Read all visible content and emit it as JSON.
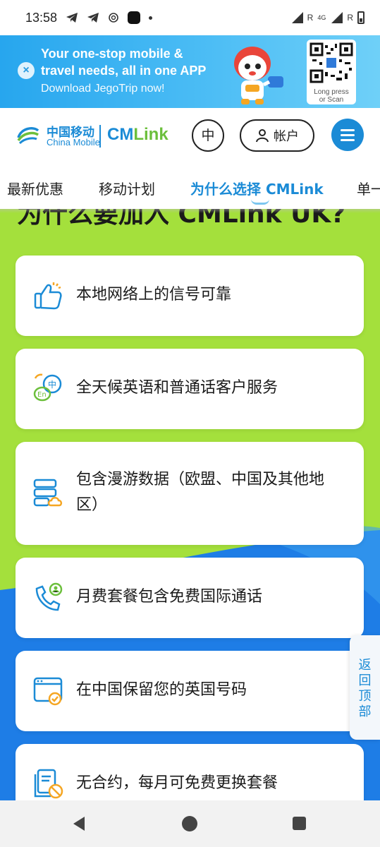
{
  "status_bar": {
    "time": "13:58",
    "icons": [
      "telegram-icon",
      "telegram-icon",
      "openai-icon",
      "app-icon",
      "dot-icon"
    ],
    "right_indicators": [
      "R",
      "4G",
      "R"
    ]
  },
  "banner": {
    "line1": "Your one-stop mobile &",
    "line2": "travel needs, all in one APP",
    "line3": "Download JegoTrip now!",
    "qr_label1": "Long press",
    "qr_label2": "or Scan"
  },
  "header": {
    "brand_cn": "中国移动",
    "brand_en": "China Mobile",
    "brand_cm": "CM",
    "brand_link": "Link",
    "lang_label": "中",
    "account_label": "帐户"
  },
  "tabs": [
    {
      "label": "最新优惠"
    },
    {
      "label": "移动计划"
    },
    {
      "label": "为什么选择 CMLink"
    },
    {
      "label": "单一"
    }
  ],
  "section": {
    "heading_cut": "为什么要加入 CMLink UK?"
  },
  "features": [
    {
      "text": "本地网络上的信号可靠",
      "icon": "thumbs-up-icon"
    },
    {
      "text": "全天候英语和普通话客户服务",
      "icon": "language-chat-icon"
    },
    {
      "text": "包含漫游数据（欧盟、中国及其他地区）",
      "icon": "cloud-data-icon"
    },
    {
      "text": "月费套餐包含免费国际通话",
      "icon": "phone-call-icon"
    },
    {
      "text": "在中国保留您的英国号码",
      "icon": "browser-check-icon"
    },
    {
      "text": "无合约，每月可免费更换套餐",
      "icon": "no-contract-icon"
    }
  ],
  "back_to_top": {
    "label": "返回顶部"
  },
  "colors": {
    "brand_blue": "#1b8bd6",
    "bg_green": "#a4e03c",
    "bg_blue": "#1e7de6"
  }
}
